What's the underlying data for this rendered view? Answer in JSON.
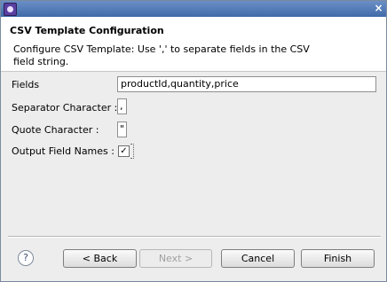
{
  "window": {
    "title": "",
    "close_glyph": "×"
  },
  "header": {
    "title": "CSV Template Configuration",
    "description": "Configure CSV Template: Use ',' to separate fields in the CSV field string."
  },
  "form": {
    "fields_label": "Fields",
    "fields_value": "productId,quantity,price",
    "separator_label": "Separator Character :",
    "separator_value": ",",
    "quote_label": "Quote Character :",
    "quote_value": "\"",
    "output_label": "Output Field Names :",
    "output_checked": true,
    "output_check_glyph": "✓"
  },
  "footer": {
    "help_glyph": "?",
    "back_label": "< Back",
    "next_label": "Next >",
    "cancel_label": "Cancel",
    "finish_label": "Finish"
  }
}
